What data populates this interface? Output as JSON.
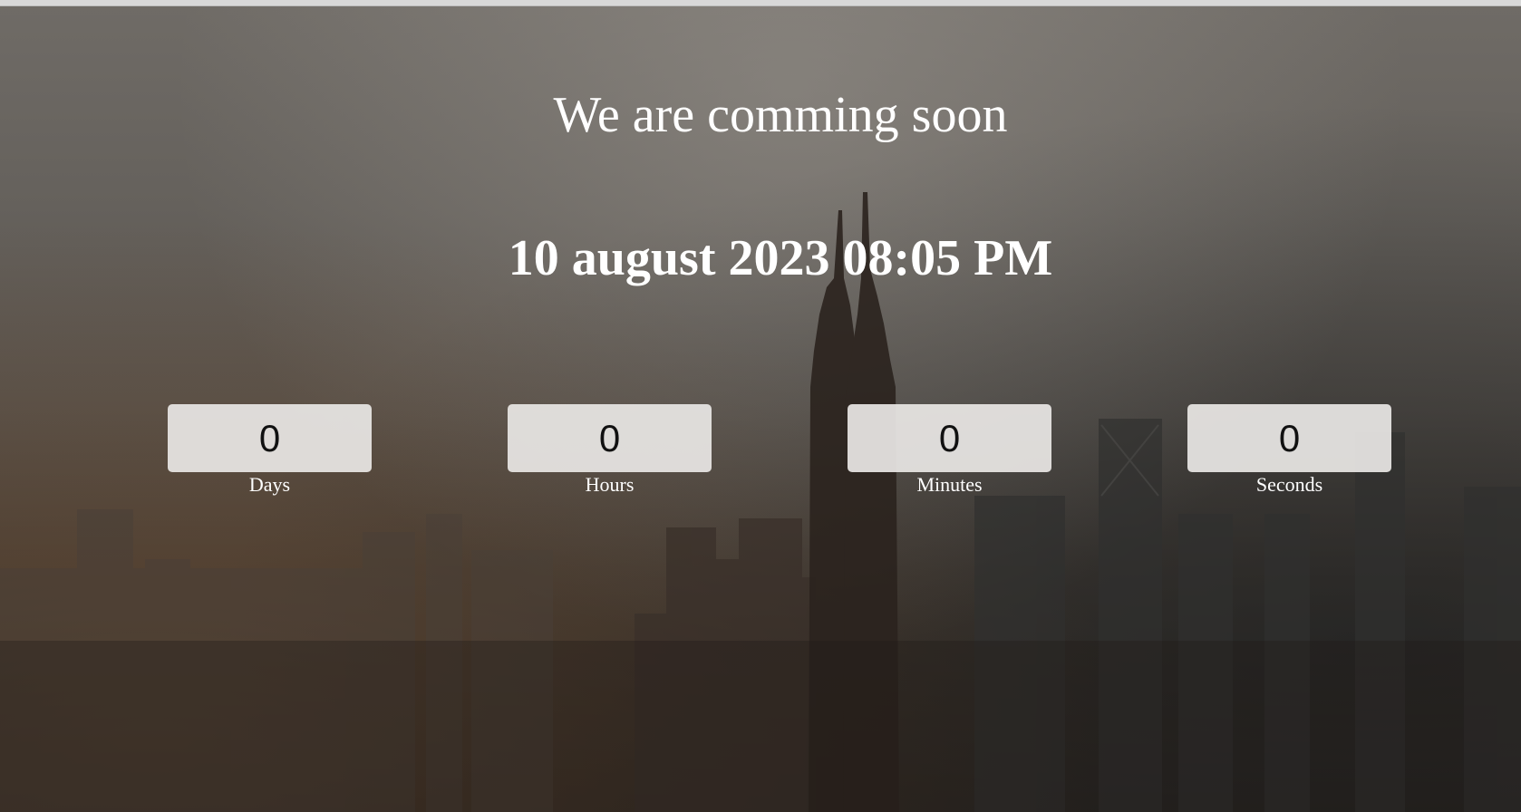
{
  "page": {
    "title": "We are comming soon",
    "target_date": "10 august 2023 08:05 PM"
  },
  "countdown": [
    {
      "value": "0",
      "label": "Days"
    },
    {
      "value": "0",
      "label": "Hours"
    },
    {
      "value": "0",
      "label": "Minutes"
    },
    {
      "value": "0",
      "label": "Seconds"
    }
  ],
  "colors": {
    "text": "#ffffff",
    "counter_box": "#e8e6e4",
    "counter_text": "#111111"
  }
}
